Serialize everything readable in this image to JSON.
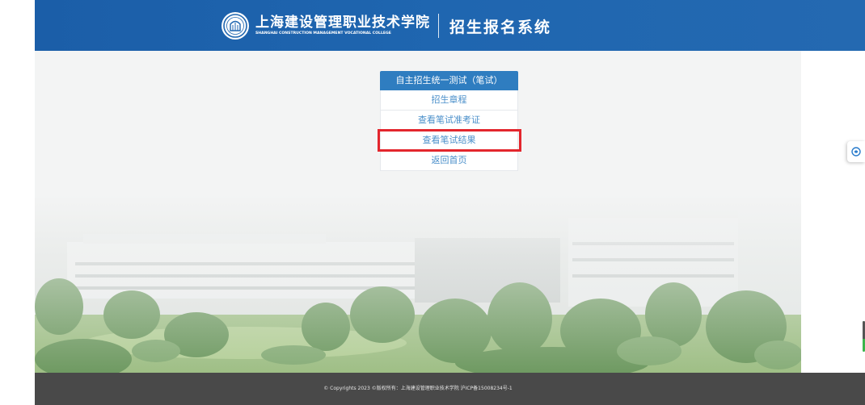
{
  "header": {
    "college_name_cn": "上海建设管理职业技术学院",
    "college_name_en": "SHANGHAI CONSTRUCTION MANAGEMENT VOCATIONAL COLLEGE",
    "system_name": "招生报名系统",
    "color": "#1f66b0"
  },
  "menu": {
    "title": "自主招生统一测试（笔试）",
    "items": [
      {
        "label": "招生章程"
      },
      {
        "label": "查看笔试准考证"
      },
      {
        "label": "查看笔试结果",
        "highlighted": true
      },
      {
        "label": "返回首页"
      }
    ],
    "title_color": "#2f7dc0",
    "item_color": "#4a8fca",
    "highlight_color": "#e3262d"
  },
  "footer": {
    "text": "© Copyrights 2023 ©版权所有：上海建设管理职业技术学院 沪ICP备15008234号-1"
  },
  "widgets": {
    "side_icon": "assistant-icon"
  }
}
